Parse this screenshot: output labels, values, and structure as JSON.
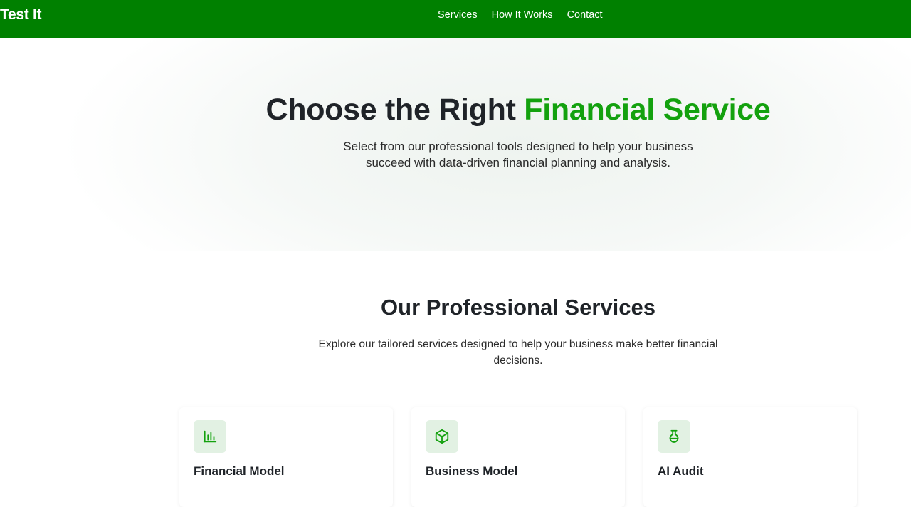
{
  "brand": {
    "logo": "Test It",
    "primary": "#008000",
    "accent": "#13a10e"
  },
  "nav": {
    "links": [
      "Services",
      "How It Works",
      "Contact"
    ]
  },
  "hero": {
    "title_main": "Choose the Right ",
    "title_accent": "Financial Service",
    "subtitle": "Select from our professional tools designed to help your business succeed with data-driven financial planning and analysis."
  },
  "services": {
    "title": "Our Professional Services",
    "subtitle": "Explore our tailored services designed to help your business make better financial decisions.",
    "cards": [
      {
        "title": "Financial Model",
        "icon": "bar-chart-icon",
        "desc": ""
      },
      {
        "title": "Business Model",
        "icon": "cube-icon",
        "desc": ""
      },
      {
        "title": "AI Audit",
        "icon": "flask-icon",
        "desc": ""
      }
    ]
  }
}
